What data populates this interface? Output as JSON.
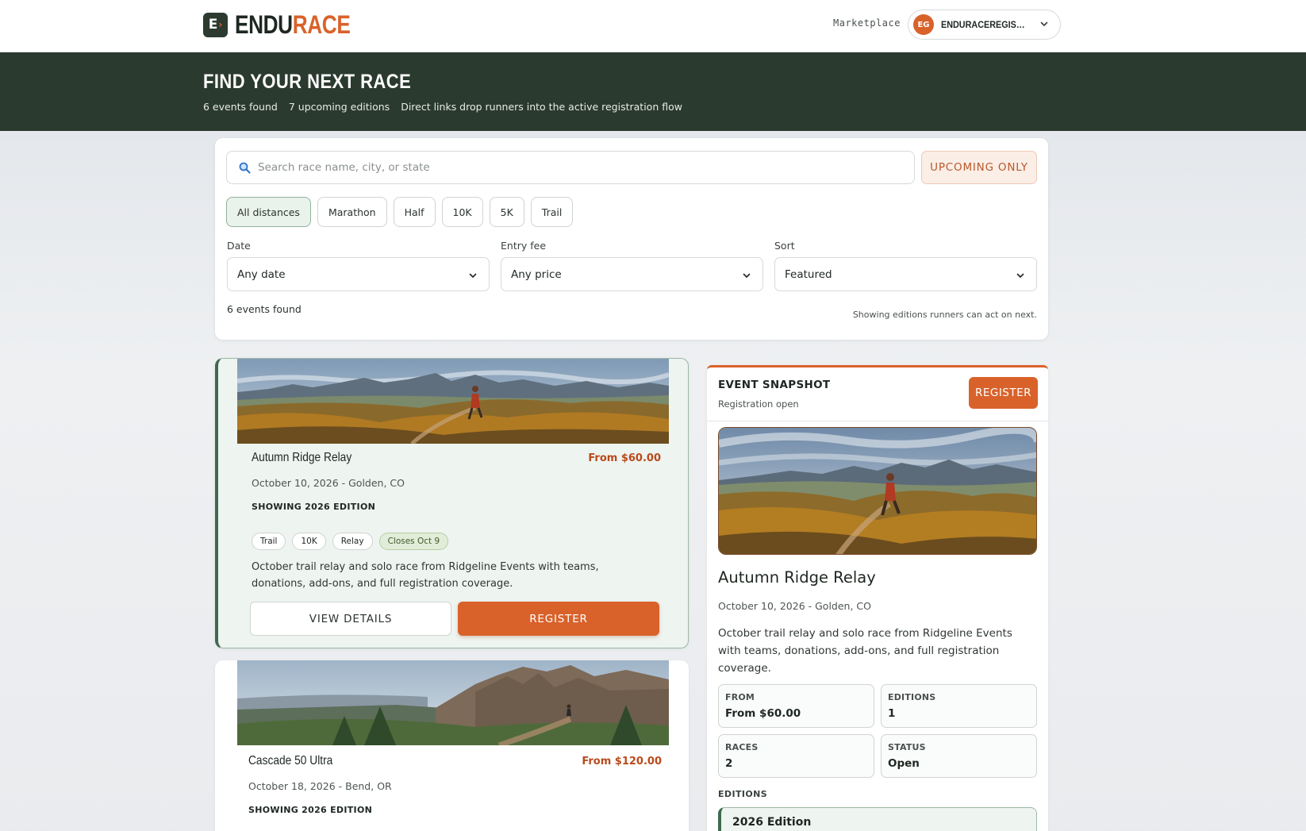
{
  "nav": {
    "logo_mark": "E",
    "logo_part1": "ENDU",
    "logo_part2": "RACE",
    "marketplace_label": "Marketplace",
    "avatar_initials": "EG",
    "account_name": "ENDURACEREGISTRATION"
  },
  "hero": {
    "title": "FIND YOUR NEXT RACE",
    "events_found": "6 events found",
    "upcoming_editions": "7 upcoming editions",
    "tagline": "Direct links drop runners into the active registration flow"
  },
  "search": {
    "placeholder": "Search race name, city, or state",
    "value": "",
    "upcoming_toggle": "UPCOMING ONLY"
  },
  "distance_chips": [
    "All distances",
    "Marathon",
    "Half",
    "10K",
    "5K",
    "Trail"
  ],
  "filters": {
    "date": {
      "label": "Date",
      "value": "Any date"
    },
    "fee": {
      "label": "Entry fee",
      "value": "Any price"
    },
    "sort": {
      "label": "Sort",
      "value": "Featured"
    }
  },
  "results": {
    "count": "6 events found",
    "note": "Showing editions runners can act on next."
  },
  "events": [
    {
      "title": "Autumn Ridge Relay",
      "price": "From $60.00",
      "date_location": "October 10, 2026 - Golden, CO",
      "edition": "SHOWING 2026 EDITION",
      "tags": [
        "Trail",
        "10K",
        "Relay"
      ],
      "closes": "Closes Oct 9",
      "description": "October trail relay and solo race from Ridgeline Events with teams, donations, add-ons, and full registration coverage.",
      "details_label": "VIEW DETAILS",
      "register_label": "REGISTER"
    },
    {
      "title": "Cascade 50 Ultra",
      "price": "From $120.00",
      "date_location": "October 18, 2026 - Bend, OR",
      "edition": "SHOWING 2026 EDITION"
    }
  ],
  "snapshot": {
    "kicker": "EVENT SNAPSHOT",
    "status_text": "Registration open",
    "register_label": "REGISTER",
    "title": "Autumn Ridge Relay",
    "date_location": "October 10, 2026 - Golden, CO",
    "description": "October trail relay and solo race from Ridgeline Events with teams, donations, add-ons, and full registration coverage.",
    "stats": {
      "from_label": "FROM",
      "from_value": "From $60.00",
      "editions_label": "EDITIONS",
      "editions_value": "1",
      "races_label": "RACES",
      "races_value": "2",
      "status_label": "STATUS",
      "status_value": "Open"
    },
    "editions_label": "EDITIONS",
    "edition_name": "2026 Edition"
  },
  "colors": {
    "accent": "#d9622b",
    "forest": "#2b3a2f",
    "selected_bg": "#eef4f0",
    "price": "#b94a1c"
  },
  "icons": [
    "search-icon",
    "chevron-down-icon"
  ]
}
